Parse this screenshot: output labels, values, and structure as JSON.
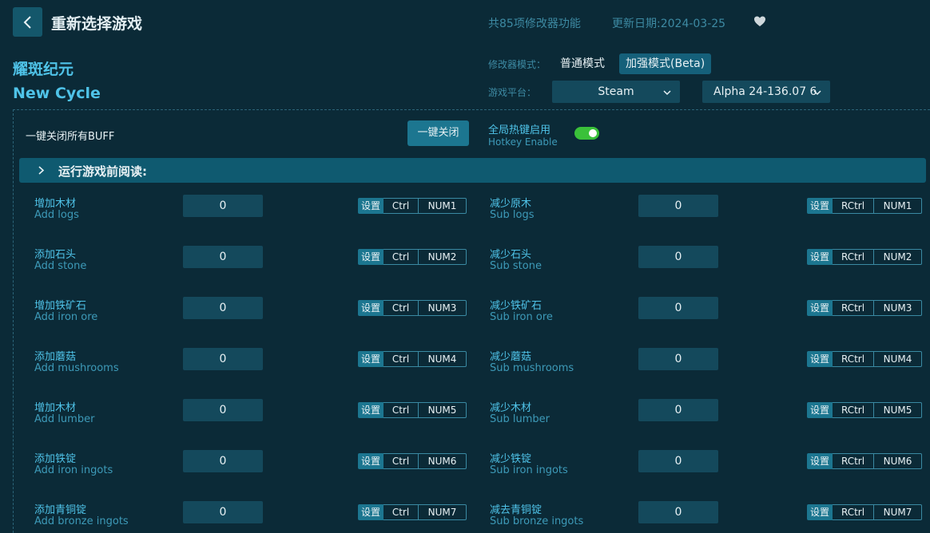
{
  "header": {
    "title": "重新选择游戏",
    "count": "共85项修改器功能",
    "date": "更新日期:2024-03-25"
  },
  "game": {
    "name_cn": "耀斑纪元",
    "name_en": "New Cycle"
  },
  "mode": {
    "label": "修改器模式：",
    "normal": "普通模式",
    "beta": "加强模式(Beta)"
  },
  "platform": {
    "label": "游戏平台：",
    "selected": "Steam",
    "version": "Alpha 24-136.07 6"
  },
  "controls": {
    "all_off_label": "一键关闭所有BUFF",
    "all_off_button": "一键关闭",
    "hotkey_cn": "全局热键启用",
    "hotkey_en": "Hotkey Enable",
    "hotkey_enabled": true
  },
  "read_section": "运行游戏前阅读:",
  "colors": {
    "accent": "#4fc3e8",
    "bg": "#0b2a37",
    "button": "#1c7690",
    "toggle_on": "#3ac13a"
  },
  "set_label": "设置",
  "items": [
    {
      "left": {
        "cn": "增加木材",
        "en": "Add logs",
        "value": "0",
        "mod": "Ctrl",
        "key": "NUM1"
      },
      "right": {
        "cn": "减少原木",
        "en": "Sub logs",
        "value": "0",
        "mod": "RCtrl",
        "key": "NUM1"
      }
    },
    {
      "left": {
        "cn": "添加石头",
        "en": "Add stone",
        "value": "0",
        "mod": "Ctrl",
        "key": "NUM2"
      },
      "right": {
        "cn": "减少石头",
        "en": "Sub stone",
        "value": "0",
        "mod": "RCtrl",
        "key": "NUM2"
      }
    },
    {
      "left": {
        "cn": "增加铁矿石",
        "en": "Add iron ore",
        "value": "0",
        "mod": "Ctrl",
        "key": "NUM3"
      },
      "right": {
        "cn": "减少铁矿石",
        "en": "Sub iron ore",
        "value": "0",
        "mod": "RCtrl",
        "key": "NUM3"
      }
    },
    {
      "left": {
        "cn": "添加蘑菇",
        "en": "Add mushrooms",
        "value": "0",
        "mod": "Ctrl",
        "key": "NUM4"
      },
      "right": {
        "cn": "减少蘑菇",
        "en": "Sub mushrooms",
        "value": "0",
        "mod": "RCtrl",
        "key": "NUM4"
      }
    },
    {
      "left": {
        "cn": "增加木材",
        "en": "Add lumber",
        "value": "0",
        "mod": "Ctrl",
        "key": "NUM5"
      },
      "right": {
        "cn": "减少木材",
        "en": "Sub lumber",
        "value": "0",
        "mod": "RCtrl",
        "key": "NUM5"
      }
    },
    {
      "left": {
        "cn": "添加铁锭",
        "en": "Add iron ingots",
        "value": "0",
        "mod": "Ctrl",
        "key": "NUM6"
      },
      "right": {
        "cn": "减少铁锭",
        "en": "Sub iron ingots",
        "value": "0",
        "mod": "RCtrl",
        "key": "NUM6"
      }
    },
    {
      "left": {
        "cn": "添加青铜锭",
        "en": "Add bronze ingots",
        "value": "0",
        "mod": "Ctrl",
        "key": "NUM7"
      },
      "right": {
        "cn": "减去青铜锭",
        "en": "Sub bronze ingots",
        "value": "0",
        "mod": "RCtrl",
        "key": "NUM7"
      }
    }
  ]
}
